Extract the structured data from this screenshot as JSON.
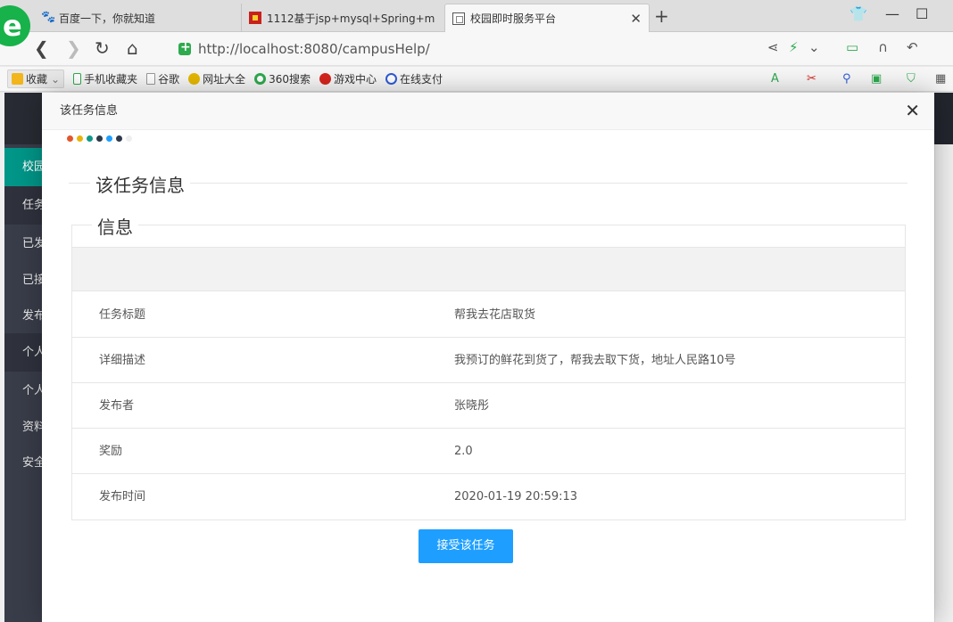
{
  "browser": {
    "tabs": [
      {
        "label": "百度一下，你就知道",
        "icon": "baidu-paw-icon"
      },
      {
        "label": "1112基于jsp+mysql+Spring+m",
        "icon": "red-square-icon"
      },
      {
        "label": "校园即时服务平台",
        "icon": "page-icon",
        "active": true
      }
    ],
    "url": "http://localhost:8080/campusHelp/",
    "bookmarks": [
      {
        "label": "收藏",
        "icon": "star-icon"
      },
      {
        "label": "手机收藏夹",
        "icon": "phone-icon"
      },
      {
        "label": "谷歌",
        "icon": "document-icon"
      },
      {
        "label": "网址大全",
        "icon": "globe-icon"
      },
      {
        "label": "360搜索",
        "icon": "search-icon"
      },
      {
        "label": "游戏中心",
        "icon": "game-icon"
      },
      {
        "label": "在线支付",
        "icon": "payment-icon"
      }
    ]
  },
  "sidebar": {
    "items": [
      {
        "label": "校园"
      },
      {
        "label": "任务"
      },
      {
        "label": "已发"
      },
      {
        "label": "已接"
      },
      {
        "label": "发布"
      },
      {
        "label": "个人"
      },
      {
        "label": "个人"
      },
      {
        "label": "资料"
      },
      {
        "label": "安全"
      }
    ]
  },
  "modal": {
    "title": "该任务信息",
    "section_title": "该任务信息",
    "panel_title": "信息",
    "rows": [
      {
        "label": "任务标题",
        "value": "帮我去花店取货"
      },
      {
        "label": "详细描述",
        "value": "我预订的鲜花到货了，帮我去取下货，地址人民路10号"
      },
      {
        "label": "发布者",
        "value": "张晓彤"
      },
      {
        "label": "奖励",
        "value": "2.0"
      },
      {
        "label": "发布时间",
        "value": "2020-01-19 20:59:13"
      }
    ],
    "accept_button": "接受该任务",
    "dot_colors": [
      "#e2562b",
      "#e8b40c",
      "#11988a",
      "#2d3848",
      "#1e9fff",
      "#2d3848",
      "#eeeeee"
    ]
  },
  "colors": {
    "accent": "#1e9fff",
    "sidebar_bg": "#393d49",
    "sidebar_active": "#009688"
  }
}
